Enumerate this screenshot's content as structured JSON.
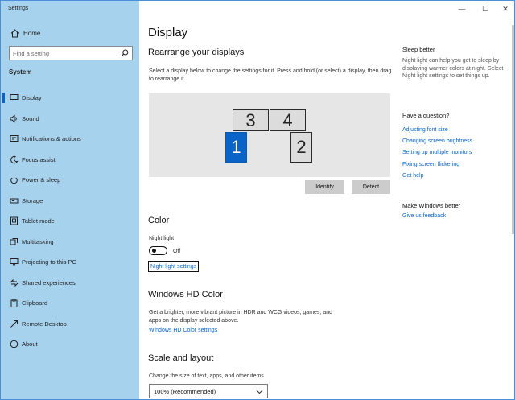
{
  "window": {
    "title": "Settings",
    "controls": {
      "minimize": "—",
      "maximize": "☐",
      "close": "✕"
    }
  },
  "sidebar": {
    "home": "Home",
    "search_placeholder": "Find a setting",
    "section": "System",
    "items": [
      {
        "label": "Display",
        "icon": "monitor-icon",
        "active": true
      },
      {
        "label": "Sound",
        "icon": "speaker-icon"
      },
      {
        "label": "Notifications & actions",
        "icon": "notification-icon"
      },
      {
        "label": "Focus assist",
        "icon": "moon-icon"
      },
      {
        "label": "Power & sleep",
        "icon": "power-icon"
      },
      {
        "label": "Storage",
        "icon": "storage-icon"
      },
      {
        "label": "Tablet mode",
        "icon": "tablet-icon"
      },
      {
        "label": "Multitasking",
        "icon": "multitasking-icon"
      },
      {
        "label": "Projecting to this PC",
        "icon": "projector-icon"
      },
      {
        "label": "Shared experiences",
        "icon": "shared-icon"
      },
      {
        "label": "Clipboard",
        "icon": "clipboard-icon"
      },
      {
        "label": "Remote Desktop",
        "icon": "remote-desktop-icon"
      },
      {
        "label": "About",
        "icon": "info-icon"
      }
    ]
  },
  "main": {
    "title": "Display",
    "rearrange": {
      "heading": "Rearrange your displays",
      "description": "Select a display below to change the settings for it. Press and hold (or select) a display, then drag to rearrange it.",
      "monitors": [
        "1",
        "2",
        "3",
        "4"
      ],
      "identify": "Identify",
      "detect": "Detect"
    },
    "color": {
      "heading": "Color",
      "night_light_label": "Night light",
      "toggle_state": "Off",
      "night_light_settings": "Night light settings"
    },
    "hdr": {
      "heading": "Windows HD Color",
      "description": "Get a brighter, more vibrant picture in HDR and WCG videos, games, and apps on the display selected above.",
      "link": "Windows HD Color settings"
    },
    "scale": {
      "heading": "Scale and layout",
      "label": "Change the size of text, apps, and other items",
      "selected": "100% (Recommended)"
    }
  },
  "right": {
    "sleep_heading": "Sleep better",
    "sleep_text": "Night light can help you get to sleep by displaying warmer colors at night. Select Night light settings to set things up.",
    "question_heading": "Have a question?",
    "links": [
      "Adjusting font size",
      "Changing screen brightness",
      "Setting up multiple monitors",
      "Fixing screen flickering",
      "Get help"
    ],
    "better_heading": "Make Windows better",
    "feedback": "Give us feedback"
  },
  "colors": {
    "accent": "#0a64c8",
    "sidebar": "#a7d2ee",
    "arrange_bg": "#e6e6e6"
  }
}
